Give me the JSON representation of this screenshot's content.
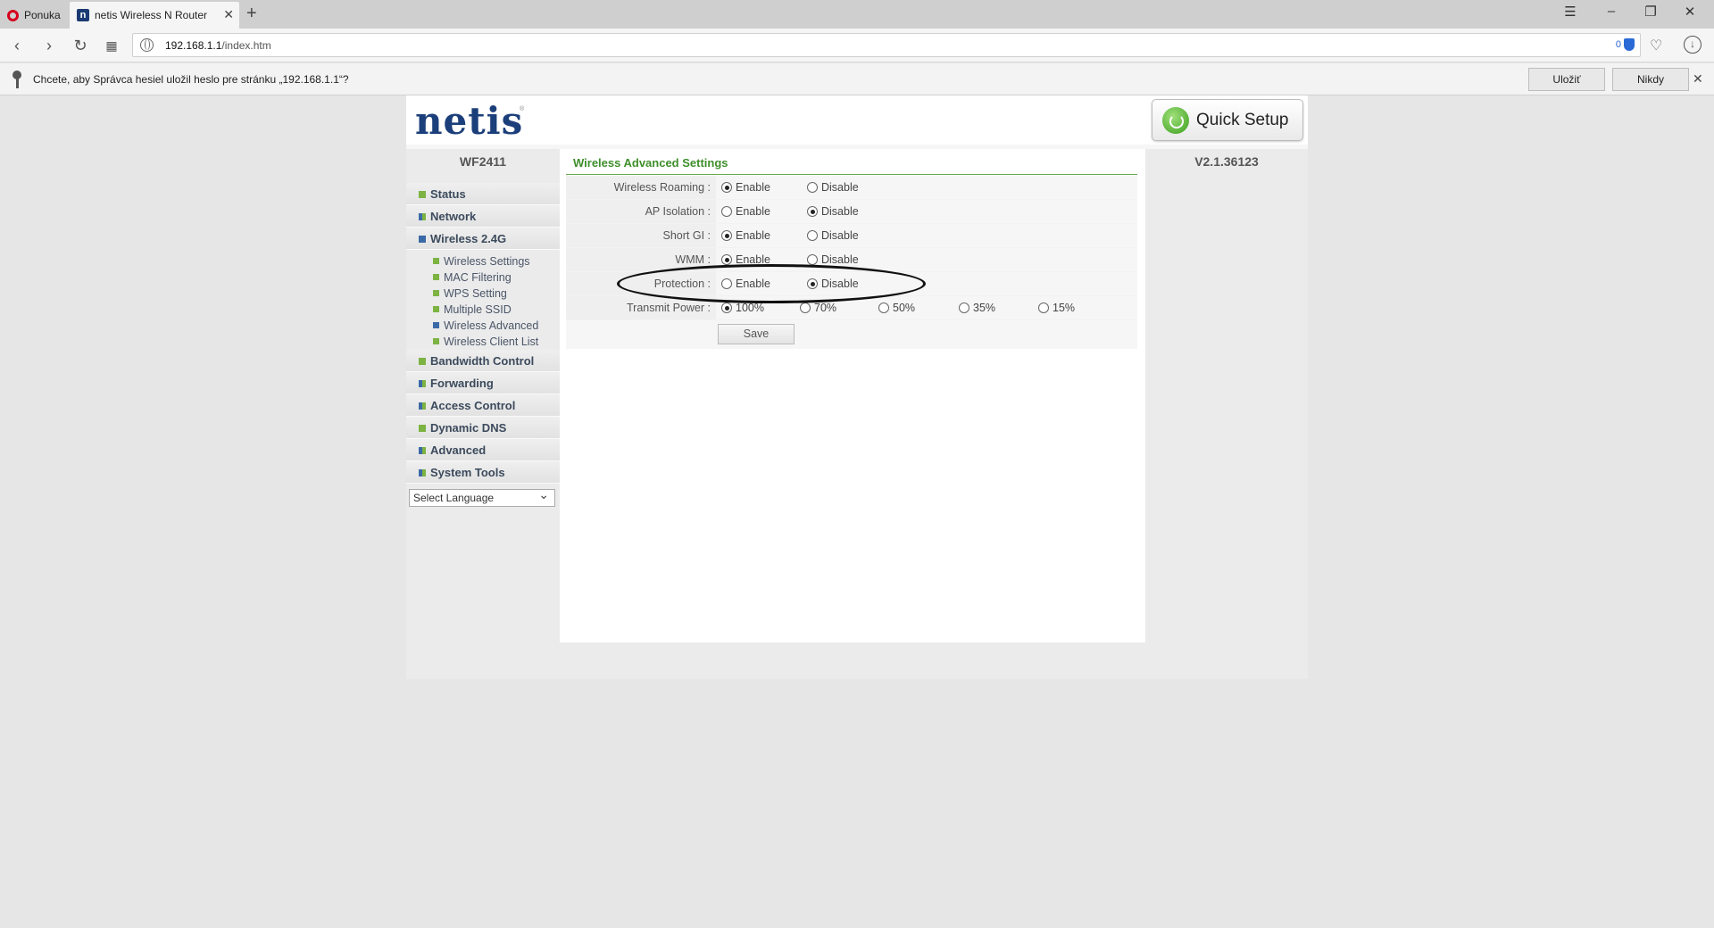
{
  "browser": {
    "menu_tab": "Ponuka",
    "active_tab_title": "netis Wireless N Router",
    "favicon_letter": "n",
    "url_host": "192.168.1.1",
    "url_path": "/index.htm",
    "ad_block_count": "0",
    "password_prompt": "Chcete, aby Správca hesiel uložil heslo pre stránku „192.168.1.1“?",
    "save_password_label": "Uložiť",
    "never_label": "Nikdy"
  },
  "router": {
    "logo": "netis",
    "logo_mark": "®",
    "quick_setup_label": "Quick Setup",
    "model": "WF2411",
    "version": "V2.1.36123",
    "menu": {
      "status": "Status",
      "network": "Network",
      "wireless": "Wireless 2.4G",
      "sub": [
        "Wireless Settings",
        "MAC Filtering",
        "WPS Setting",
        "Multiple SSID",
        "Wireless Advanced",
        "Wireless Client List"
      ],
      "bandwidth": "Bandwidth Control",
      "forwarding": "Forwarding",
      "access": "Access Control",
      "ddns": "Dynamic DNS",
      "advanced": "Advanced",
      "tools": "System Tools"
    },
    "language_select": "Select Language"
  },
  "settings": {
    "title": "Wireless Advanced Settings",
    "enable": "Enable",
    "disable": "Disable",
    "rows": [
      {
        "label": "Wireless Roaming :",
        "selected": "Enable"
      },
      {
        "label": "AP Isolation :",
        "selected": "Disable"
      },
      {
        "label": "Short GI :",
        "selected": "Enable"
      },
      {
        "label": "WMM :",
        "selected": "Enable"
      },
      {
        "label": "Protection :",
        "selected": "Disable"
      }
    ],
    "transmit_power": {
      "label": "Transmit Power :",
      "options": [
        "100%",
        "70%",
        "50%",
        "35%",
        "15%"
      ],
      "selected": "100%"
    },
    "save_label": "Save"
  }
}
